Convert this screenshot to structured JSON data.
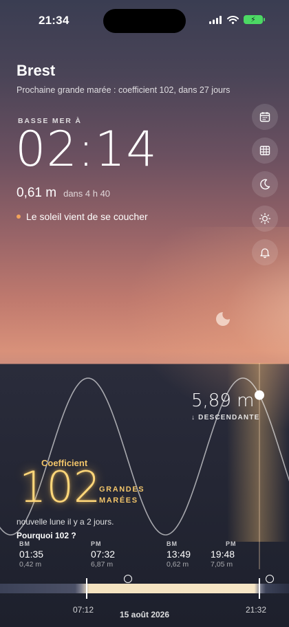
{
  "status": {
    "time": "21:34"
  },
  "location": {
    "city": "Brest",
    "next_big_tide": "Prochaine grande marée : coefficient 102, dans 27 jours"
  },
  "current_tide": {
    "kind_label": "BASSE MER À",
    "time": "02:14",
    "height": "0,61 m",
    "in": "dans 4 h 40",
    "sun_status": "Le soleil vient de se coucher"
  },
  "side_buttons": [
    "calendar-icon",
    "table-icon",
    "moon-icon",
    "sun-icon",
    "bell-icon"
  ],
  "now": {
    "height": "5,89 m",
    "direction": "↓ DESCENDANTE"
  },
  "coefficient": {
    "label": "Coefficient",
    "value": "102",
    "category": "GRANDES MARÉES",
    "moon_phase": "nouvelle lune il y a 2 jours.",
    "why_link": "Pourquoi 102 ?"
  },
  "tides": [
    {
      "kind": "BM",
      "time": "01:35",
      "height": "0,42 m"
    },
    {
      "kind": "PM",
      "time": "07:32",
      "height": "6,87 m"
    },
    {
      "kind": "BM",
      "time": "13:49",
      "height": "0,62 m"
    },
    {
      "kind": "PM",
      "time": "19:48",
      "height": "7,05 m"
    }
  ],
  "day": {
    "sunrise": "07:12",
    "sunset": "21:32",
    "date": "15 août 2026"
  },
  "colors": {
    "coefficient": "#ffd77a",
    "sun_dot": "#f2a35a",
    "battery": "#4cd964"
  }
}
